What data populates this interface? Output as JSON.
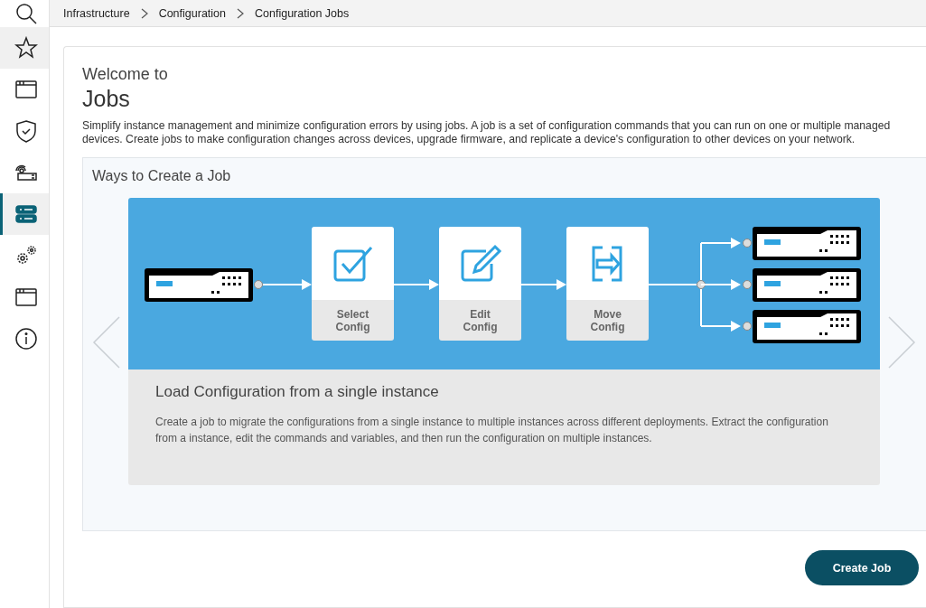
{
  "sidebar": {
    "items": [
      {
        "selected": false,
        "hovered": false
      },
      {
        "selected": false,
        "hovered": true
      },
      {
        "selected": false,
        "hovered": false
      },
      {
        "selected": false,
        "hovered": false
      },
      {
        "selected": false,
        "hovered": false
      },
      {
        "selected": true,
        "hovered": false
      },
      {
        "selected": false,
        "hovered": false
      },
      {
        "selected": false,
        "hovered": false
      },
      {
        "selected": false,
        "hovered": false
      }
    ]
  },
  "breadcrumb": [
    "Infrastructure",
    "Configuration",
    "Configuration Jobs"
  ],
  "welcome": {
    "kicker": "Welcome to",
    "title": "Jobs",
    "description": "Simplify instance management and minimize configuration errors by using jobs. A job is a set of configuration commands that you can run on one or multiple managed devices. Create jobs to make configuration changes across devices, upgrade firmware, and replicate a device's configuration to other devices on your network."
  },
  "ways": {
    "title": "Ways to Create a Job",
    "steps": [
      {
        "label": "Select Config"
      },
      {
        "label": "Edit Config"
      },
      {
        "label": "Move Config"
      }
    ],
    "slide_title": "Load Configuration from a single instance",
    "slide_description": "Create a job to migrate the configurations from a single instance to multiple instances across different deployments. Extract the configuration from a instance, edit the commands and variables, and then run the configuration on multiple instances."
  },
  "actions": {
    "create_button": "Create Job"
  }
}
